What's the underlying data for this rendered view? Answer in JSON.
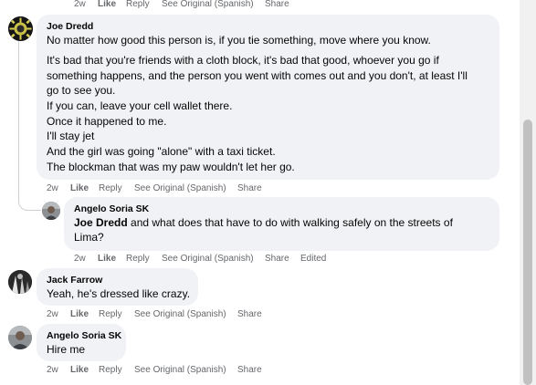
{
  "actions": {
    "time_label": "2w",
    "like_label": "Like",
    "reply_label": "Reply",
    "see_original_label": "See Original (Spanish)",
    "share_label": "Share",
    "edited_label": "Edited"
  },
  "comments": [
    {
      "author": "Joe Dredd",
      "lines": [
        "No matter how good this person is, if you tie something, move where you know.",
        "",
        "It's bad that you're friends with a cloth block, it's bad that good, whoever you go if",
        "something happens, and the person you went with comes out and you don't, at least I'll",
        "go to see you.",
        "If you can, leave your cell wallet there.",
        "Once it happened to me.",
        "I'll stay jet",
        "And the girl was going \"alone\" with a taxi ticket.",
        "The blockman that was my paw wouldn't let her go."
      ]
    },
    {
      "author": "Angelo Soria SK",
      "mention": "Joe Dredd",
      "line1_rest": " and what does that have to do with walking safely on the streets of",
      "line2": "Lima?"
    },
    {
      "author": "Jack Farrow",
      "lines": [
        "Yeah, he's dressed like crazy."
      ]
    },
    {
      "author": "Angelo Soria SK",
      "lines": [
        "Hire me"
      ]
    }
  ]
}
